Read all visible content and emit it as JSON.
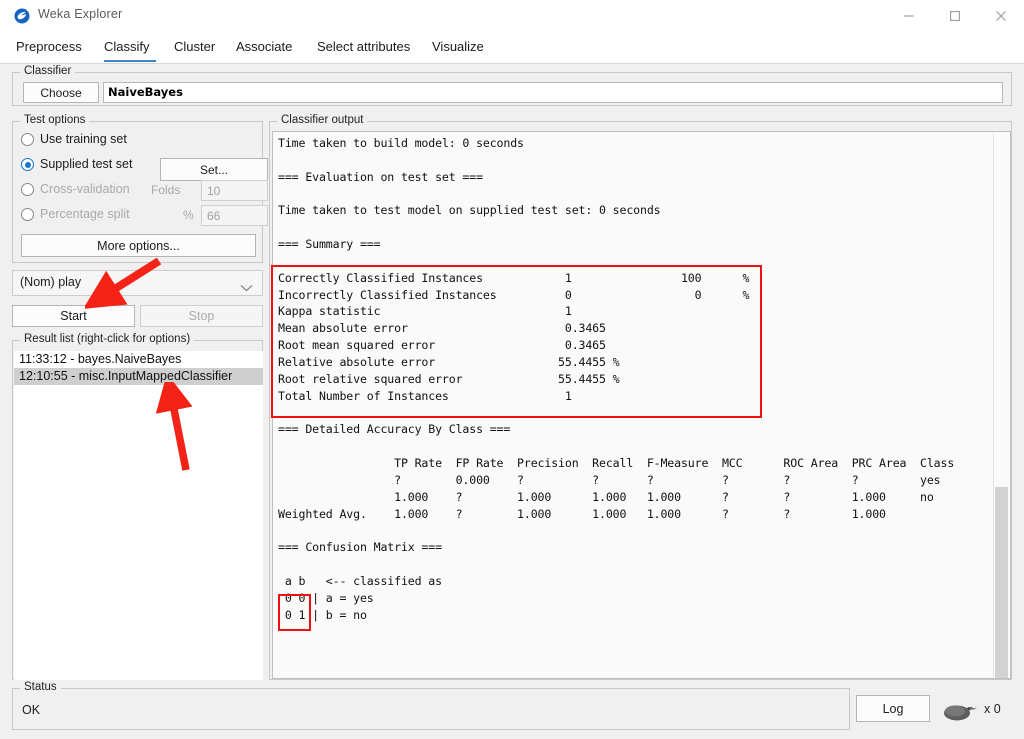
{
  "window": {
    "title": "Weka Explorer",
    "icon": "weka-bird-icon",
    "controls": {
      "minimize": "minimize-icon",
      "maximize": "maximize-icon",
      "close": "close-icon"
    }
  },
  "tabs": [
    {
      "label": "Preprocess",
      "active": false
    },
    {
      "label": "Classify",
      "active": true
    },
    {
      "label": "Cluster",
      "active": false
    },
    {
      "label": "Associate",
      "active": false
    },
    {
      "label": "Select attributes",
      "active": false
    },
    {
      "label": "Visualize",
      "active": false
    }
  ],
  "classifier": {
    "group_label": "Classifier",
    "choose_label": "Choose",
    "value": "NaiveBayes"
  },
  "test_options": {
    "group_label": "Test options",
    "items": [
      {
        "label": "Use training set",
        "selected": false
      },
      {
        "label": "Supplied test set",
        "selected": true
      },
      {
        "label": "Cross-validation",
        "selected": false
      },
      {
        "label": "Percentage split",
        "selected": false
      }
    ],
    "set_button": "Set...",
    "folds_label": "Folds",
    "folds_value": "10",
    "percent_label": "%",
    "percent_value": "66",
    "more_options_button": "More options..."
  },
  "class_combo": {
    "value": "(Nom) play",
    "arrow_icon": "chevron-down-icon"
  },
  "actions": {
    "start_label": "Start",
    "stop_label": "Stop"
  },
  "result_list": {
    "group_label": "Result list (right-click for options)",
    "items": [
      {
        "label": "11:33:12 - bayes.NaiveBayes",
        "selected": false
      },
      {
        "label": "12:10:55 - misc.InputMappedClassifier",
        "selected": true
      }
    ]
  },
  "output": {
    "group_label": "Classifier output",
    "text": "Time taken to build model: 0 seconds\n\n=== Evaluation on test set ===\n\nTime taken to test model on supplied test set: 0 seconds\n\n=== Summary ===\n\nCorrectly Classified Instances            1                100      %\nIncorrectly Classified Instances          0                  0      %\nKappa statistic                           1     \nMean absolute error                       0.3465\nRoot mean squared error                   0.3465\nRelative absolute error                  55.4455 %\nRoot relative squared error              55.4455 %\nTotal Number of Instances                 1     \n\n=== Detailed Accuracy By Class ===\n\n                 TP Rate  FP Rate  Precision  Recall  F-Measure  MCC      ROC Area  PRC Area  Class\n                 ?        0.000    ?          ?       ?          ?        ?         ?         yes\n                 1.000    ?        1.000      1.000   1.000      ?        ?         1.000     no\nWeighted Avg.    1.000    ?        1.000      1.000   1.000      ?        ?         1.000     \n\n=== Confusion Matrix ===\n\n a b   <-- classified as\n 0 0 | a = yes\n 0 1 | b = no"
  },
  "status": {
    "group_label": "Status",
    "text": "OK",
    "log_button": "Log",
    "bird_icon": "weka-bird-icon",
    "bird_count": "x 0"
  },
  "annotations": {
    "highlight_color": "#ee1111",
    "summary_box": "summary-highlight",
    "confusion_box": "confusion-matrix-highlight",
    "arrow_start": "arrow-pointing-to-start-button",
    "arrow_result": "arrow-pointing-to-result-list-item"
  }
}
